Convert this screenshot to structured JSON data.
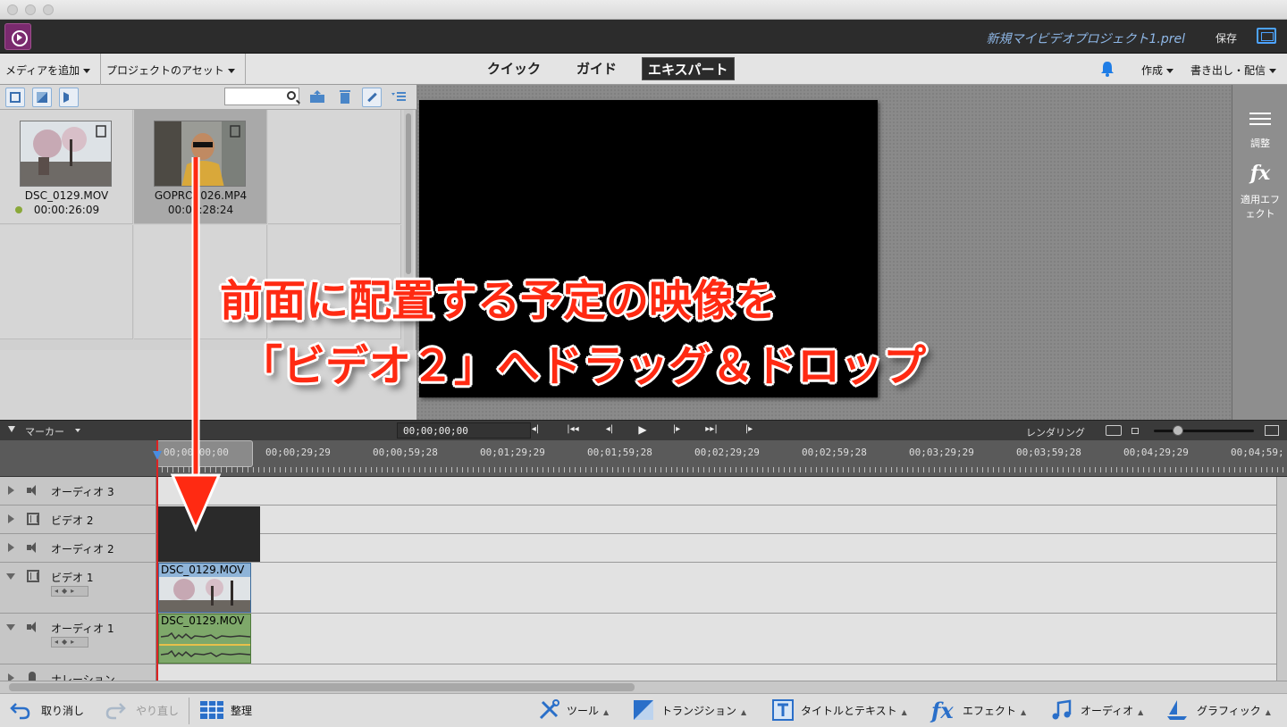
{
  "window": {
    "project_name": "新規マイビデオプロジェクト1.prel",
    "save_label": "保存"
  },
  "toolbar": {
    "add_media": "メディアを追加",
    "project_assets": "プロジェクトのアセット",
    "modes": [
      "クイック",
      "ガイド",
      "エキスパート"
    ],
    "active_mode": "エキスパート",
    "create": "作成",
    "export_share": "書き出し・配信"
  },
  "assets": [
    {
      "name": "DSC_0129.MOV",
      "duration": "00:00:26:09",
      "status_color": "#8aa83a"
    },
    {
      "name": "GOPRO0026.MP4",
      "duration": "00:00:28:24",
      "selected": true
    }
  ],
  "side_panel": {
    "adjust": "調整",
    "applied_effects": "適用エフェクト"
  },
  "annotation": {
    "line1": "前面に配置する予定の映像を",
    "line2": "「ビデオ２」へドラッグ＆ドロップ"
  },
  "timeline": {
    "marker_label": "マーカー",
    "timecode": "00;00;00;00",
    "render_label": "レンダリング",
    "ruler_labels": [
      "00;00;00;00",
      "00;00;29;29",
      "00;00;59;28",
      "00;01;29;29",
      "00;01;59;28",
      "00;02;29;29",
      "00;02;59;28",
      "00;03;29;29",
      "00;03;59;28",
      "00;04;29;29",
      "00;04;59;"
    ],
    "tracks": [
      {
        "name": "オーディオ 3",
        "kind": "audio"
      },
      {
        "name": "ビデオ 2",
        "kind": "video"
      },
      {
        "name": "オーディオ 2",
        "kind": "audio"
      },
      {
        "name": "ビデオ 1",
        "kind": "video",
        "clip": "DSC_0129.MOV"
      },
      {
        "name": "オーディオ 1",
        "kind": "audio",
        "clip": "DSC_0129.MOV"
      },
      {
        "name": "ナレーション",
        "kind": "narration"
      }
    ]
  },
  "bottombar": {
    "undo": "取り消し",
    "redo": "やり直し",
    "organize": "整理",
    "tools": "ツール",
    "transitions": "トランジション",
    "titles_text": "タイトルとテキスト",
    "effects": "エフェクト",
    "audio": "オーディオ",
    "graphics": "グラフィック"
  },
  "colors": {
    "accent_blue": "#4da3ff",
    "annotation_red": "#ff2a12",
    "playhead": "#d22222"
  }
}
